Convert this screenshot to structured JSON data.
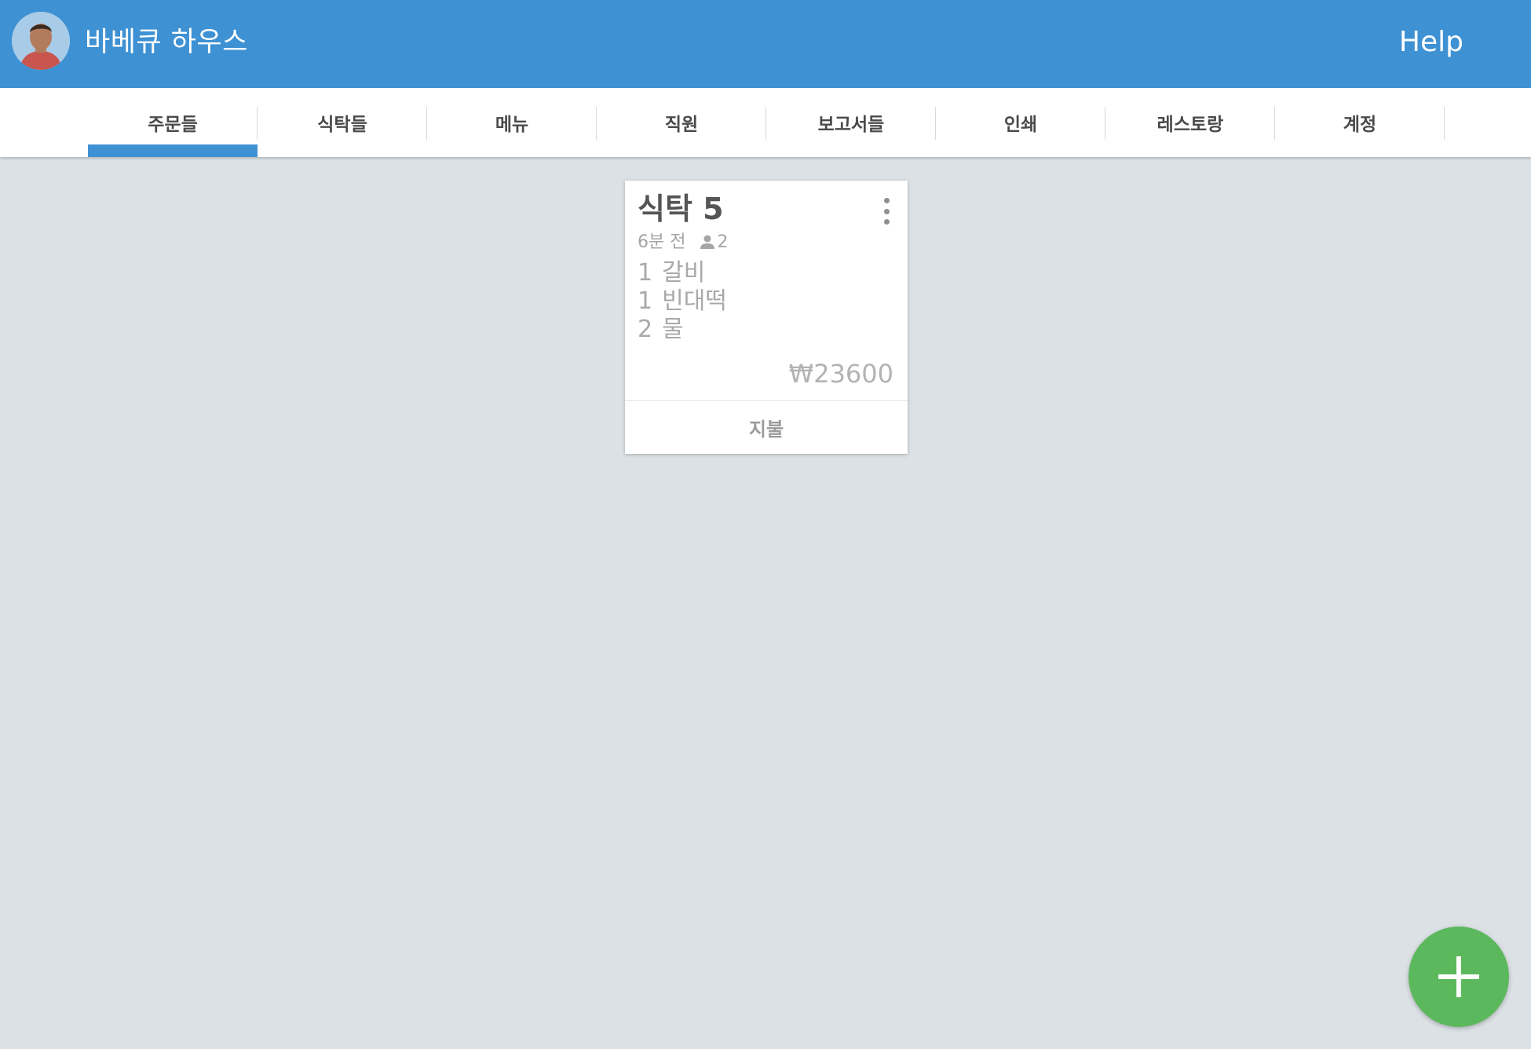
{
  "header": {
    "title": "바베큐 하우스",
    "help_label": "Help",
    "colors": {
      "bar": "#3e91d3"
    }
  },
  "tabs": [
    {
      "label": "주문들",
      "active": true
    },
    {
      "label": "식탁들",
      "active": false
    },
    {
      "label": "메뉴",
      "active": false
    },
    {
      "label": "직원",
      "active": false
    },
    {
      "label": "보고서들",
      "active": false
    },
    {
      "label": "인쇄",
      "active": false
    },
    {
      "label": "레스토랑",
      "active": false
    },
    {
      "label": "계정",
      "active": false
    }
  ],
  "order": {
    "title": "식탁 5",
    "elapsed": "6분 전",
    "guests": "2",
    "items": [
      {
        "qty": "1",
        "name": "갈비"
      },
      {
        "qty": "1",
        "name": "빈대떡"
      },
      {
        "qty": "2",
        "name": "물"
      }
    ],
    "total": "₩23600",
    "pay_label": "지불"
  },
  "fab": {
    "icon": "plus-icon",
    "color": "#5cb85c"
  }
}
